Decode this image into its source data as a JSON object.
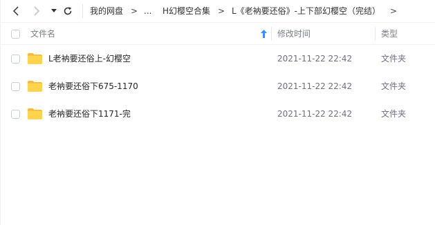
{
  "toolbar": {
    "breadcrumbs": [
      "我的网盘",
      "...",
      "H幻樱空合集",
      "L《老衲要还俗》-上下部幻樱空（完结）"
    ],
    "separator": ">"
  },
  "header": {
    "name_label": "文件名",
    "date_label": "修改时间",
    "type_label": "类型"
  },
  "files": [
    {
      "name": "L老衲要还俗上-幻樱空",
      "modified": "2021-11-22 22:42",
      "type": "文件夹"
    },
    {
      "name": "老衲要还俗下675-1170",
      "modified": "2021-11-22 22:42",
      "type": "文件夹"
    },
    {
      "name": "老衲要还俗下1171-完",
      "modified": "2021-11-22 22:42",
      "type": "文件夹"
    }
  ],
  "colors": {
    "folder": "#FFD34E",
    "folder_back": "#F7B93E",
    "sort_arrow": "#3b8cff"
  }
}
